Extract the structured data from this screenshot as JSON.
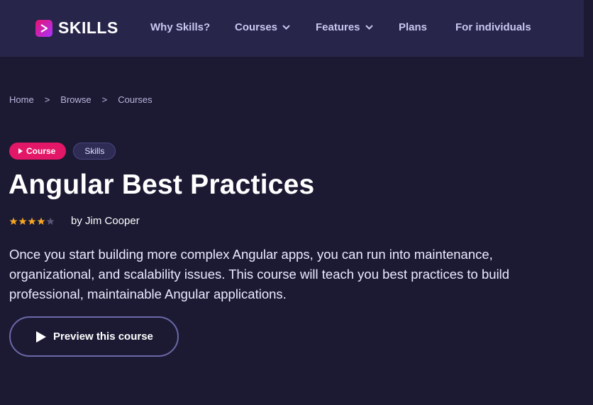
{
  "header": {
    "logo_text": "SKILLS",
    "nav": [
      {
        "label": "Why Skills?",
        "has_dropdown": false
      },
      {
        "label": "Courses",
        "has_dropdown": true
      },
      {
        "label": "Features",
        "has_dropdown": true
      },
      {
        "label": "Plans",
        "has_dropdown": false
      },
      {
        "label": "For individuals",
        "has_dropdown": false
      }
    ]
  },
  "breadcrumb": {
    "items": [
      "Home",
      "Browse",
      "Courses"
    ],
    "separator": ">"
  },
  "badges": {
    "type_label": "Course",
    "product_label": "Skills"
  },
  "course": {
    "title": "Angular Best Practices",
    "rating": 4,
    "rating_max": 5,
    "author": "by Jim Cooper",
    "description": "Once you start building more complex Angular apps, you can run into maintenance, organizational, and scalability issues. This course will teach you best practices to build professional, maintainable Angular applications."
  },
  "cta": {
    "preview_label": "Preview this course"
  },
  "colors": {
    "page_bg": "#1c1a33",
    "header_bg": "#28254a",
    "accent_pink": "#e31767",
    "star_gold": "#f5a623",
    "star_empty": "#5a5878"
  },
  "icons": {
    "logo": "play-logo-icon",
    "dropdown": "chevron-down-icon",
    "badge": "play-triangle-icon",
    "rating": "star-icon",
    "cta": "play-icon"
  }
}
